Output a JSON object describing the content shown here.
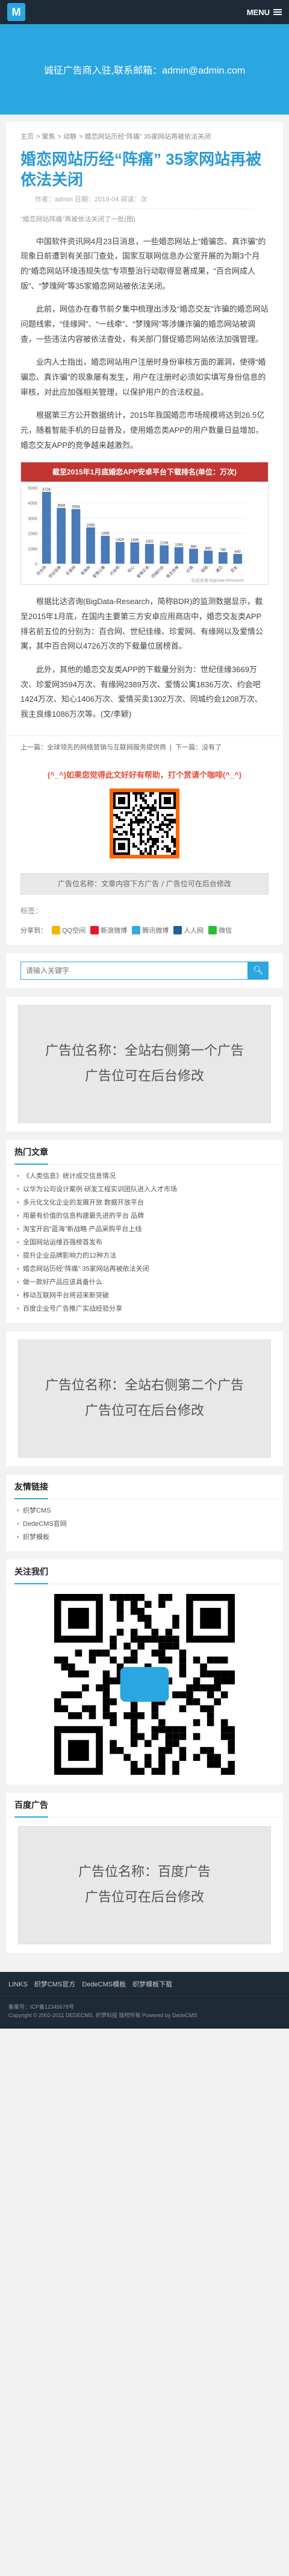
{
  "header": {
    "logo_text": "M",
    "menu_label": "MENU"
  },
  "banner": {
    "text": "诚征广告商入驻,联系邮箱：admin@admin.com"
  },
  "breadcrumb": [
    "主页",
    "聚焦",
    "动静",
    "婚恋网站历经“阵痛” 35家网站再被依法关闭"
  ],
  "article": {
    "title": "婚恋网站历经“阵痛” 35家网站再被依法关闭",
    "meta": "作者：admin 日期：2019-04 阅读：次",
    "summary": "“婚恋网站阵痛”再被依法关闭了一批(图)",
    "paragraphs": [
      "中国软件资讯网4月23日消息，一些婚恋网站上“婚骗恋、真诈骗”的现象日前遭到有关部门查处，国家互联网信息办公室开展的为期3个月的“婚恋网站环境违规失信”专项整治行动取得显著成果，“百合网成人版”、“梦瑰网”等35家婚恋网站被依法关闭。",
      "此前，网信办在春节前夕集中梳理出涉及“婚恋交友”诈骗的婚恋网站问题线索，“佳缘网”、“一线牵”、“梦瑰网”等涉嫌诈骗的婚恋网站被调查，一些违法内容被依法查处，有关部门督促婚恋网站依法加强管理。",
      "业内人士指出，婚恋网站用户注册时身份审核方面的漏洞，使得“婚骗恋、真诈骗”的现象屡有发生，用户在注册时必须如实填写身份信息的审核，对此应加强相关管理，以保护用户的合法权益。",
      "根据第三方公开数据统计，2015年我国婚恋市场规模将达到26.5亿元，随着智能手机的日益普及，使用婚恋类APP的用户数量日益增加，婚恋交友APP的竞争越来越激烈。"
    ],
    "paragraphs2": [
      "根据比达咨询(BigData-Research，简称BDR)的监测数据显示，截至2015年1月底，在国内主要第三方安卓应用商店中，婚恋交友类APP排名前五位的分别为：百合网、世纪佳缘、珍爱网、有缘网以及爱情公寓，其中百合网以4726万次的下载量位居榜首。",
      "此外，其他的婚恋交友类APP的下载量分别为：世纪佳缘3669万次、珍爱网3594万次、有缘网2389万次、爱情公寓1836万次、约会吧1424万次、知心1406万次、爱情买卖1302万次、同城约会1208万次、我主良缘1086万次等。(文/李颖)"
    ],
    "prev": "上一篇：全球领先的网络营销与互联网服务提供商",
    "next": "下一篇：没有了"
  },
  "chart_data": {
    "type": "bar",
    "title": "截至2015年1月底婚恋APP安卓平台下载排名(单位：万次)",
    "categories": [
      "百合网",
      "世纪佳缘",
      "珍爱网",
      "有缘网",
      "爱情公寓",
      "约会吧",
      "知心",
      "爱情买卖",
      "同城约会",
      "我主良缘",
      "红娘",
      "陌陌",
      "遇见",
      "觅友"
    ],
    "values": [
      4726,
      3669,
      3594,
      2389,
      1836,
      1424,
      1406,
      1302,
      1208,
      1086,
      980,
      860,
      760,
      640
    ],
    "ylim": [
      0,
      5000
    ],
    "bar_color": "#4a7ab8",
    "watermark": "比达咨询 BigData-Research"
  },
  "promo": {
    "red_text": "(^_^)如果您觉得此文好好有帮助，打个赏请个咖啡(^_^)",
    "ad_bar": "广告位名称：文章内容下方广告 / 广告位可在后台修改"
  },
  "tags_label": "标签：",
  "share": {
    "label": "分享到：",
    "items": [
      {
        "name": "QQ空间",
        "color": "#f5b400"
      },
      {
        "name": "新浪微博",
        "color": "#e6162d"
      },
      {
        "name": "腾讯微博",
        "color": "#3aa6e0"
      },
      {
        "name": "人人网",
        "color": "#1d5e9f"
      },
      {
        "name": "微信",
        "color": "#2ebb2e"
      }
    ]
  },
  "search": {
    "placeholder": "请输入关键字"
  },
  "ad1": {
    "line1": "广告位名称：全站右侧第一个广告",
    "line2": "广告位可在后台修改"
  },
  "hot": {
    "title": "热门文章",
    "items": [
      "《人类信息》统计成交信息情况",
      "以华为公司设计案例 研发工程实训团队进入人才市场",
      "多元化文化企业的发展开放 数据开放平台",
      "用最有价值的信息构建最先进的平台 品牌",
      "淘宝开启“蓝海”新战略 产品采购平台上线",
      "全国网站运维百强榜首发布",
      "提升企业品牌影响力的12种方法",
      "婚恋网站历经“阵痛” 35家网站再被依法关闭",
      "做一款好产品应该具备什么",
      "移动互联网平台将迎来新突破",
      "百度企业号广告推广实战经验分享"
    ]
  },
  "ad2": {
    "line1": "广告位名称：全站右侧第二个广告",
    "line2": "广告位可在后台修改"
  },
  "links": {
    "title": "友情链接",
    "items": [
      "织梦CMS",
      "DedeCMS官网",
      "织梦模板"
    ]
  },
  "follow": {
    "title": "关注我们"
  },
  "baidu": {
    "title": "百度广告",
    "line1": "广告位名称：百度广告",
    "line2": "广告位可在后台修改"
  },
  "footer": {
    "nav": [
      "LINKS",
      "织梦CMS官方",
      "DedeCMS模板",
      "织梦模板下载"
    ],
    "copyright": "Copyright © 2002-2011 DEDECMS. 织梦科技 版权所有 Powered by DedeCMS",
    "icp": "备案号：ICP备12345678号"
  }
}
